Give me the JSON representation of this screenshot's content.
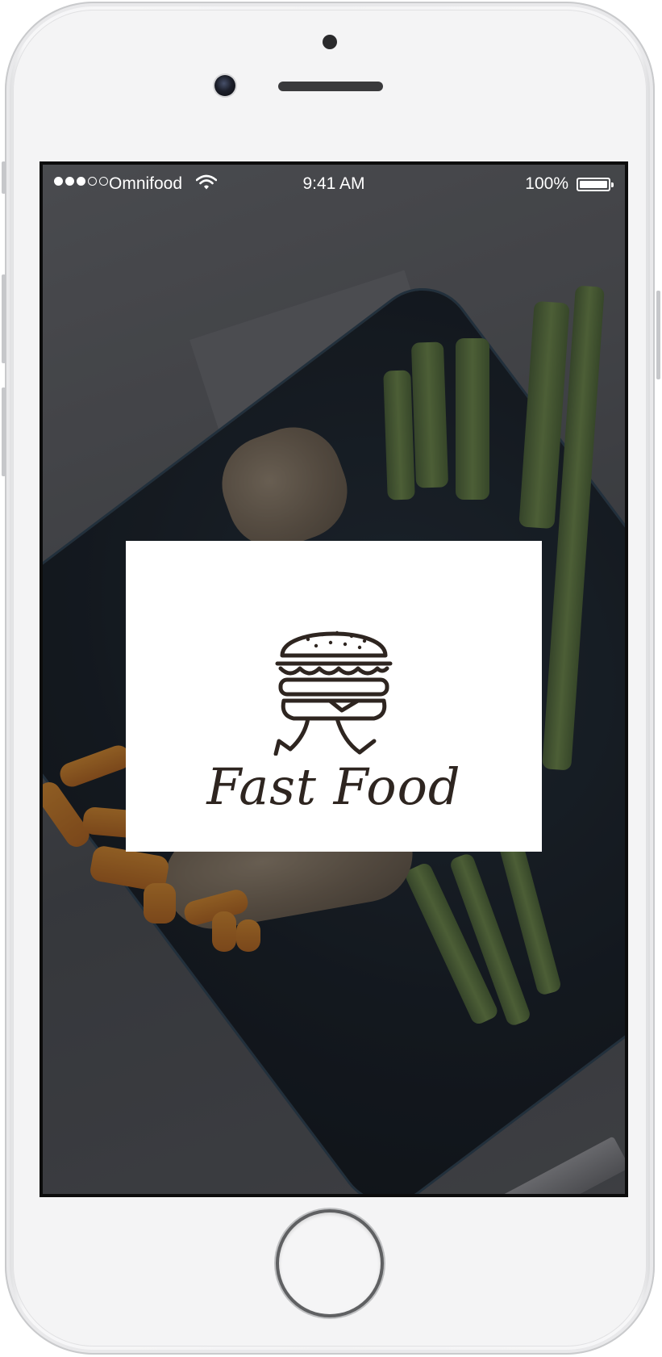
{
  "status_bar": {
    "carrier": "Omnifood",
    "time": "9:41 AM",
    "battery_percent": "100%",
    "signal_strength": 3,
    "signal_max": 5,
    "icons": [
      "signal-dots-icon",
      "wifi-icon",
      "battery-icon"
    ]
  },
  "splash": {
    "brand_name": "Fast Food",
    "logo_icon": "running-burger-icon",
    "card_color": "#ffffff",
    "text_color": "#2e2520"
  }
}
